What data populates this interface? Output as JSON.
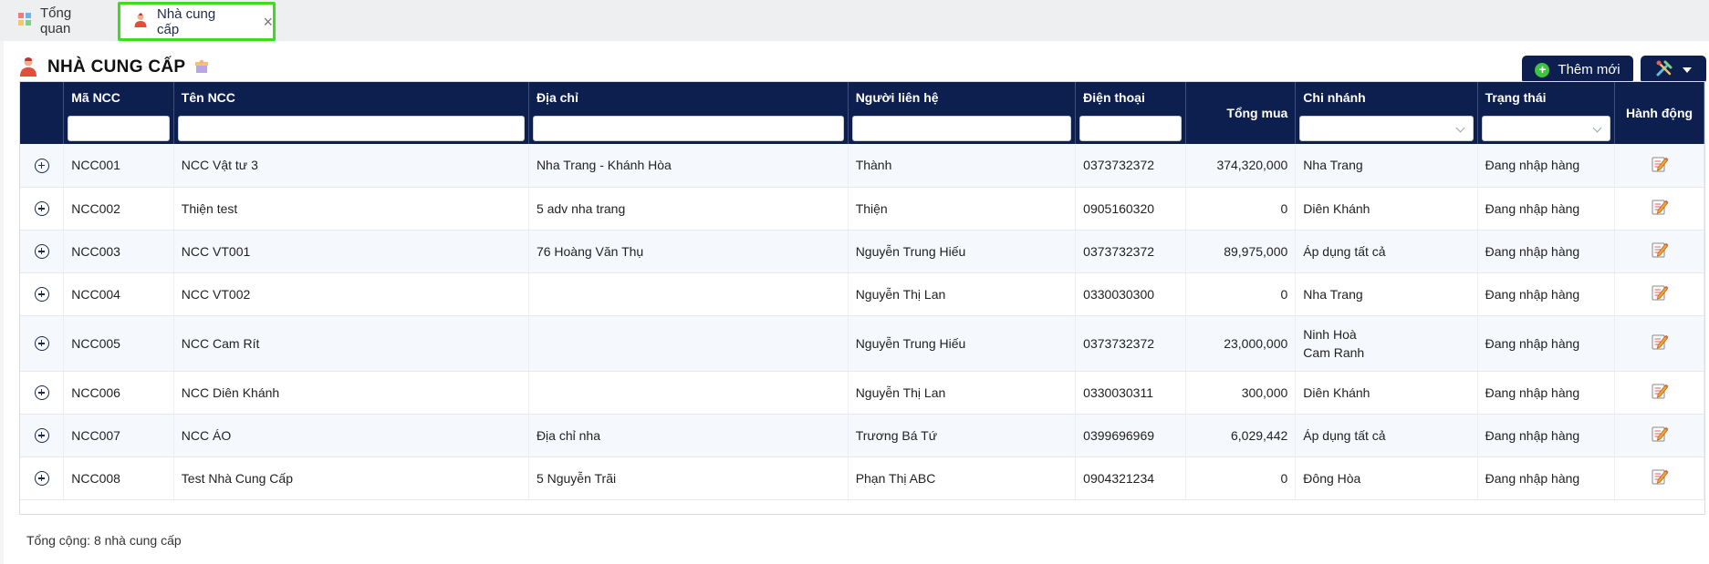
{
  "tabs": [
    {
      "label": "Tổng quan",
      "icon": "dashboard-grid-icon"
    },
    {
      "label": "Nhà cung cấp",
      "icon": "supplier-person-icon",
      "active": true
    }
  ],
  "page": {
    "title": "NHÀ CUNG CẤP",
    "add_button": "Thêm mới",
    "tools_icon": "tools-icon"
  },
  "colors": {
    "header_navy": "#0d1f4f",
    "active_tab_border": "#3ddc1f",
    "add_plus_green": "#3ec43e"
  },
  "table": {
    "headers": {
      "code": "Mã NCC",
      "name": "Tên NCC",
      "address": "Địa chỉ",
      "contact": "Người liên hệ",
      "phone": "Điện thoại",
      "total": "Tổng mua",
      "branch": "Chi nhánh",
      "status": "Trạng thái",
      "action": "Hành động"
    },
    "rows": [
      {
        "code": "NCC001",
        "name": "NCC Vật tư 3",
        "address": "Nha Trang - Khánh Hòa",
        "contact": "Thành",
        "phone": "0373732372",
        "total": "374,320,000",
        "branch": [
          "Nha Trang"
        ],
        "status": "Đang nhập hàng"
      },
      {
        "code": "NCC002",
        "name": "Thiện test",
        "address": "5 adv nha trang",
        "contact": "Thiện",
        "phone": "0905160320",
        "total": "0",
        "branch": [
          "Diên Khánh"
        ],
        "status": "Đang nhập hàng"
      },
      {
        "code": "NCC003",
        "name": "NCC VT001",
        "address": "76 Hoàng Văn Thụ",
        "contact": "Nguyễn Trung Hiếu",
        "phone": "0373732372",
        "total": "89,975,000",
        "branch": [
          "Áp dụng tất cả"
        ],
        "status": "Đang nhập hàng"
      },
      {
        "code": "NCC004",
        "name": "NCC VT002",
        "address": "",
        "contact": "Nguyễn Thị Lan",
        "phone": "0330030300",
        "total": "0",
        "branch": [
          "Nha Trang"
        ],
        "status": "Đang nhập hàng"
      },
      {
        "code": "NCC005",
        "name": "NCC Cam Rít",
        "address": "",
        "contact": "Nguyễn Trung Hiếu",
        "phone": "0373732372",
        "total": "23,000,000",
        "branch": [
          "Ninh Hoà",
          "Cam Ranh"
        ],
        "status": "Đang nhập hàng"
      },
      {
        "code": "NCC006",
        "name": "NCC Diên Khánh",
        "address": "",
        "contact": "Nguyễn Thị Lan",
        "phone": "0330030311",
        "total": "300,000",
        "branch": [
          "Diên Khánh"
        ],
        "status": "Đang nhập hàng"
      },
      {
        "code": "NCC007",
        "name": "NCC ÁO",
        "address": "Địa chỉ nha",
        "contact": "Trương Bá Tứ",
        "phone": "0399696969",
        "total": "6,029,442",
        "branch": [
          "Áp dụng tất cả"
        ],
        "status": "Đang nhập hàng"
      },
      {
        "code": "NCC008",
        "name": "Test Nhà Cung Cấp",
        "address": "5 Nguyễn Trãi",
        "contact": "Phạn Thị ABC",
        "phone": "0904321234",
        "total": "0",
        "branch": [
          "Đông Hòa"
        ],
        "status": "Đang nhập hàng"
      }
    ],
    "footer": "Tổng cộng: 8 nhà cung cấp"
  }
}
